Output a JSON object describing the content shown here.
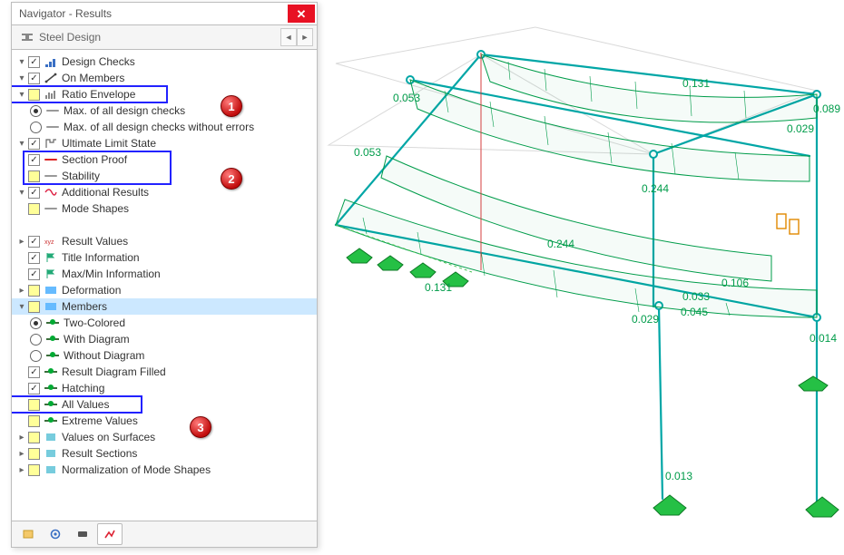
{
  "window": {
    "title": "Navigator - Results",
    "close_tooltip": "Close"
  },
  "toolbar": {
    "dropdown_label": "Steel Design"
  },
  "tree": {
    "design_checks": {
      "label": "Design Checks",
      "on_members": {
        "label": "On Members"
      },
      "ratio_envelope": {
        "label": "Ratio Envelope"
      },
      "max_all": {
        "label": "Max. of all design checks"
      },
      "max_all_no_err": {
        "label": "Max. of all design checks without errors"
      },
      "uls": {
        "label": "Ultimate Limit State"
      },
      "section_proof": {
        "label": "Section Proof"
      },
      "stability": {
        "label": "Stability"
      }
    },
    "additional_results": {
      "label": "Additional Results",
      "mode_shapes": {
        "label": "Mode Shapes"
      }
    },
    "result_values": {
      "label": "Result Values"
    },
    "title_info": {
      "label": "Title Information"
    },
    "maxmin": {
      "label": "Max/Min Information"
    },
    "deformation": {
      "label": "Deformation"
    },
    "members": {
      "label": "Members",
      "two_colored": {
        "label": "Two-Colored"
      },
      "with_diagram": {
        "label": "With Diagram"
      },
      "without_diagram": {
        "label": "Without Diagram"
      },
      "result_diagram_filled": {
        "label": "Result Diagram Filled"
      },
      "hatching": {
        "label": "Hatching"
      },
      "all_values": {
        "label": "All Values"
      },
      "extreme_values": {
        "label": "Extreme Values"
      }
    },
    "values_on_surfaces": {
      "label": "Values on Surfaces"
    },
    "result_sections": {
      "label": "Result Sections"
    },
    "normalization": {
      "label": "Normalization of Mode Shapes"
    }
  },
  "markers": {
    "m1": "1",
    "m2": "2",
    "m3": "3"
  },
  "model_values": {
    "v0053a": "0.053",
    "v0053b": "0.053",
    "v0131a": "0.131",
    "v0131b": "0.131",
    "v0244a": "0.244",
    "v0244b": "0.244",
    "v0089": "0.089",
    "v0029a": "0.029",
    "v0029b": "0.029",
    "v0033": "0.033",
    "v0045": "0.045",
    "v0106": "0.106",
    "v0014": "0.014",
    "v0013": "0.013"
  }
}
